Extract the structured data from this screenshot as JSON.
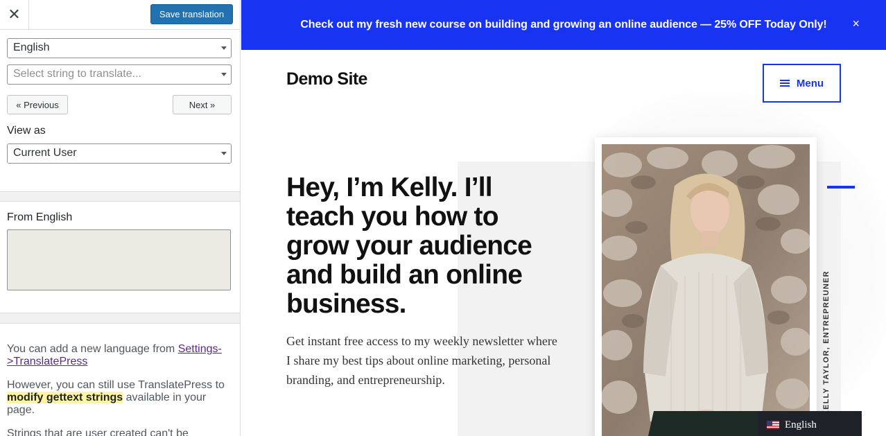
{
  "editor": {
    "close_icon": "close-icon",
    "close_glyph": "✕",
    "save_label": "Save translation",
    "language_select": "English",
    "string_select_placeholder": "Select string to translate...",
    "previous_label": "« Previous",
    "next_label": "Next »",
    "view_as_label": "View as",
    "view_as_value": "Current User",
    "from_label": "From English",
    "info": {
      "p1_prefix": "You can add a new language from ",
      "p1_link": "Settings->TranslatePress",
      "p2_prefix": "However, you can still use TranslatePress to ",
      "p2_highlight": "modify gettext strings",
      "p2_suffix": " available in your page.",
      "p3": "Strings that are user created can't be"
    }
  },
  "preview": {
    "banner_text": "Check out my fresh new course on building and growing an online audience — 25% OFF Today Only!",
    "banner_close": "×",
    "site_title": "Demo Site",
    "menu_label": "Menu",
    "headline": "Hey, I’m Kelly. I’ll teach you how to grow your audience and build an online business.",
    "intro": "Get instant free access to my weekly newsletter where I share my best tips about online marketing, personal branding, and entrepreneurship.",
    "vertical_caption": "KELLY TAYLOR, ENTREPREUNER",
    "language_switcher": "English",
    "colors": {
      "brand_blue": "#1933f3",
      "wp_blue": "#2271b1"
    }
  }
}
